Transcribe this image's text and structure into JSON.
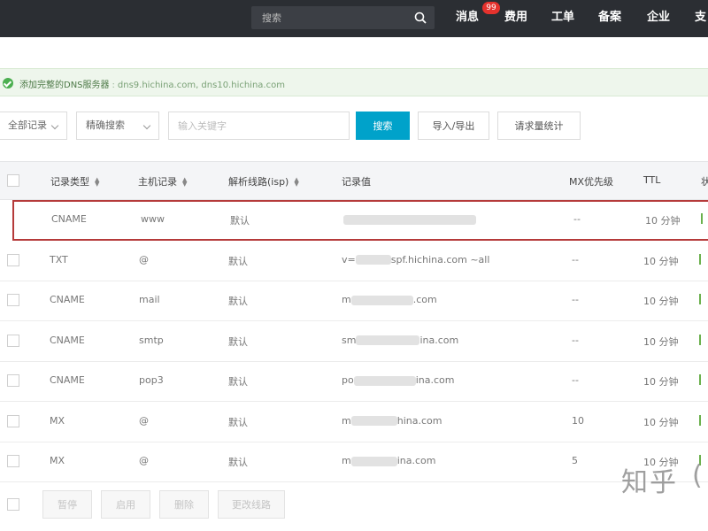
{
  "topbar": {
    "search_placeholder": "搜索",
    "nav": [
      "消息",
      "费用",
      "工单",
      "备案",
      "企业",
      "支"
    ],
    "message_badge": "99"
  },
  "notice": {
    "text": "添加完整的DNS服务器",
    "separator": ":",
    "domains": "dns9.hichina.com, dns10.hichina.com"
  },
  "filters": {
    "record_type": "全部记录",
    "match_mode": "精确搜索",
    "keyword_placeholder": "输入关键字",
    "search_button": "搜索",
    "import_button": "导入/导出",
    "stats_button": "请求量统计"
  },
  "table": {
    "headers": [
      "记录类型",
      "主机记录",
      "解析线路(isp)",
      "记录值",
      "MX优先级",
      "TTL",
      "状"
    ],
    "rows": [
      {
        "type": "CNAME",
        "host": "www",
        "line": "默认",
        "value_prefix": "",
        "value_suffix": "",
        "mx": "--",
        "ttl": "10 分钟",
        "highlighted": true
      },
      {
        "type": "TXT",
        "host": "@",
        "line": "默认",
        "value_prefix": "v=",
        "value_suffix": "spf.hichina.com ~all",
        "mx": "--",
        "ttl": "10 分钟",
        "highlighted": false
      },
      {
        "type": "CNAME",
        "host": "mail",
        "line": "默认",
        "value_prefix": "m",
        "value_suffix": ".com",
        "mx": "--",
        "ttl": "10 分钟",
        "highlighted": false
      },
      {
        "type": "CNAME",
        "host": "smtp",
        "line": "默认",
        "value_prefix": "sm",
        "value_suffix": "ina.com",
        "mx": "--",
        "ttl": "10 分钟",
        "highlighted": false
      },
      {
        "type": "CNAME",
        "host": "pop3",
        "line": "默认",
        "value_prefix": "po",
        "value_suffix": "ina.com",
        "mx": "--",
        "ttl": "10 分钟",
        "highlighted": false
      },
      {
        "type": "MX",
        "host": "@",
        "line": "默认",
        "value_prefix": "m",
        "value_suffix": "hina.com",
        "mx": "10",
        "ttl": "10 分钟",
        "highlighted": false
      },
      {
        "type": "MX",
        "host": "@",
        "line": "默认",
        "value_prefix": "m",
        "value_suffix": "ina.com",
        "mx": "5",
        "ttl": "10 分钟",
        "highlighted": false
      }
    ]
  },
  "footer": {
    "buttons": [
      "暂停",
      "启用",
      "删除",
      "更改线路"
    ]
  },
  "watermark": "知乎",
  "watermark_paren": "(",
  "colors": {
    "topbar": "#2b2e33",
    "primary": "#00a2ca",
    "highlight_border": "#b53a3a",
    "notice_bg": "#eef6ec",
    "badge": "#e5322d"
  }
}
